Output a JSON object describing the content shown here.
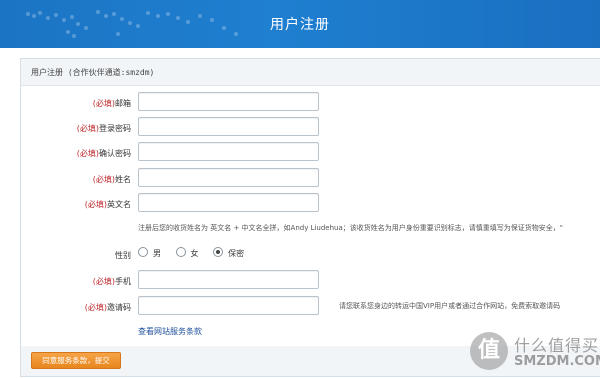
{
  "header": {
    "title": "用户注册"
  },
  "panel": {
    "heading": "用户注册 (合作伙伴通道:smzdm)"
  },
  "fields": [
    {
      "required": "(必填)",
      "label": "邮箱"
    },
    {
      "required": "(必填)",
      "label": "登录密码"
    },
    {
      "required": "(必填)",
      "label": "确认密码"
    },
    {
      "required": "(必填)",
      "label": "姓名"
    },
    {
      "required": "(必填)",
      "label": "英文名"
    }
  ],
  "english_name_hint": "注册后您的收货姓名为 英文名 + 中文名全拼，如Andy Liudehua；该收货姓名为用户身份重要识别标志，请慎重填写为保证货物安全，\"",
  "gender": {
    "label": "性别",
    "options": [
      {
        "label": "男",
        "selected": false
      },
      {
        "label": "女",
        "selected": false
      },
      {
        "label": "保密",
        "selected": true
      }
    ]
  },
  "phone": {
    "required": "(必填)",
    "label": "手机"
  },
  "invite": {
    "required": "(必填)",
    "label": "邀请码",
    "note": "请您联系您身边的转运中国VIP用户或者通过合作网站，免费索取邀请码"
  },
  "terms_link": "查看网站服务条款",
  "submit_label": "同意服务条款，提交",
  "watermark": {
    "glyph": "值",
    "line1": "什么值得买",
    "line2": "SMZDM.COM"
  }
}
